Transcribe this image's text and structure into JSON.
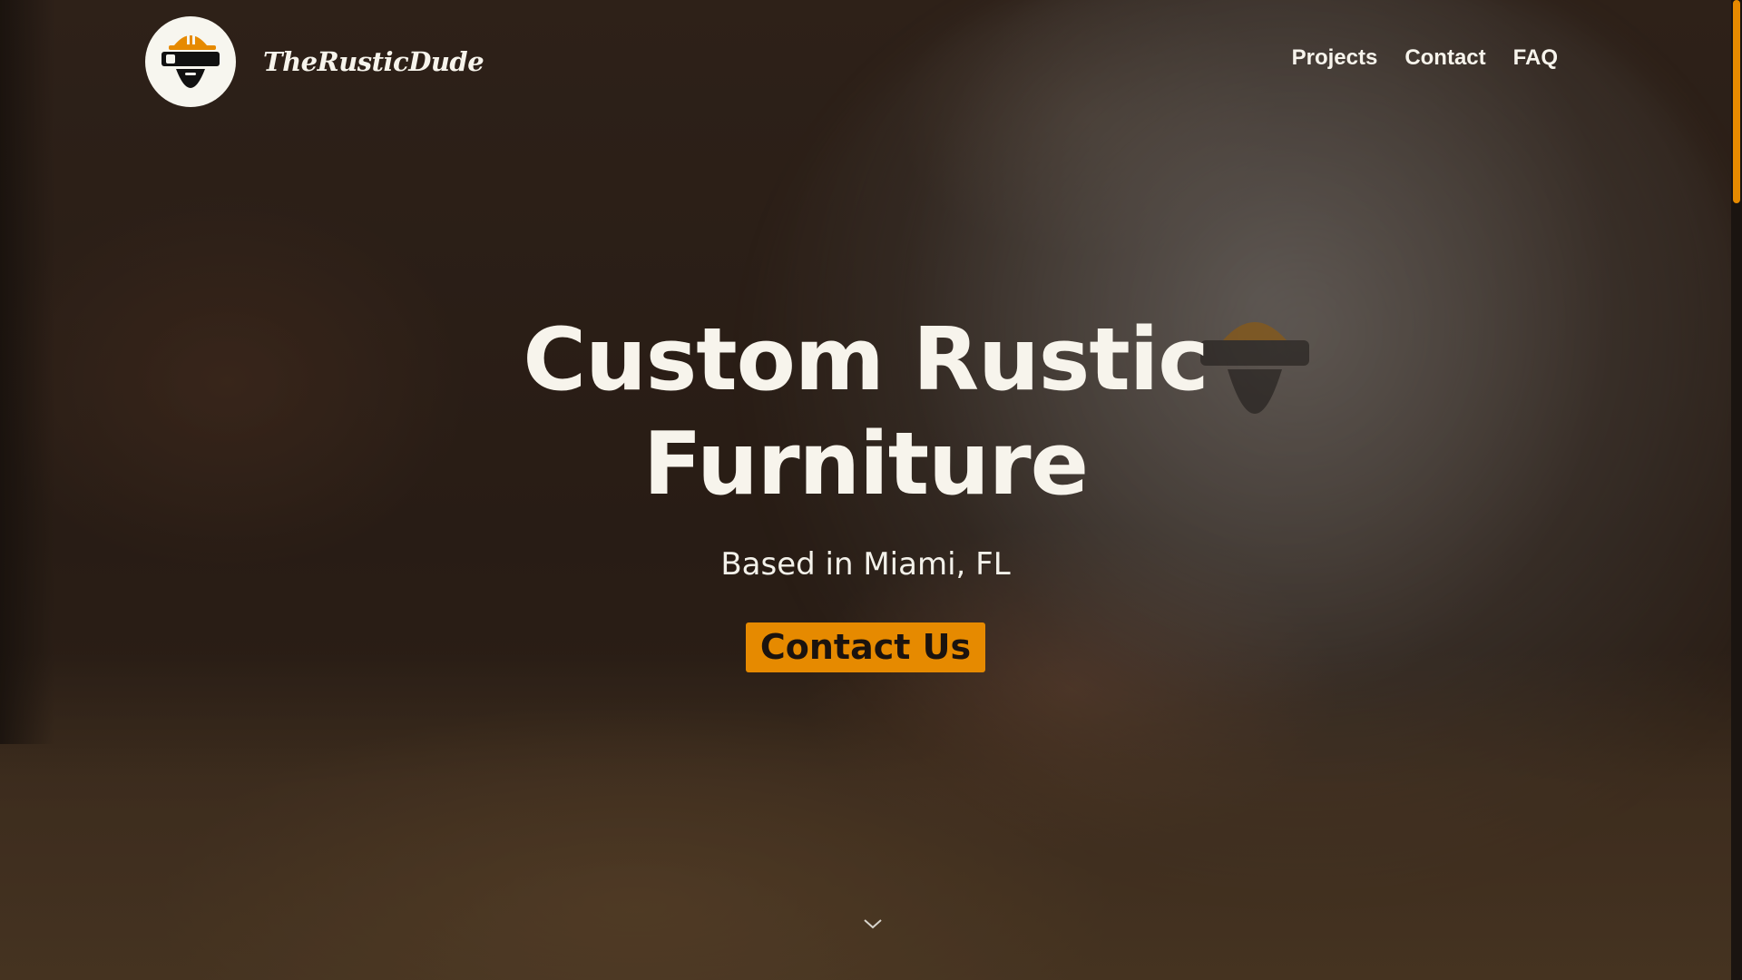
{
  "header": {
    "brand_name": "TheRusticDude",
    "logo_icon": "bearded-worker-hardhat-icon",
    "nav": [
      {
        "label": "Projects"
      },
      {
        "label": "Contact"
      },
      {
        "label": "FAQ"
      }
    ]
  },
  "hero": {
    "title": "Custom Rustic Furniture",
    "subtitle": "Based in Miami, FL",
    "cta_label": "Contact Us",
    "scroll_icon": "chevron-down-icon"
  },
  "colors": {
    "accent": "#e68a00",
    "text": "#f7f4ec",
    "logo_bg": "#f7f6ef",
    "logo_dark": "#111111"
  }
}
